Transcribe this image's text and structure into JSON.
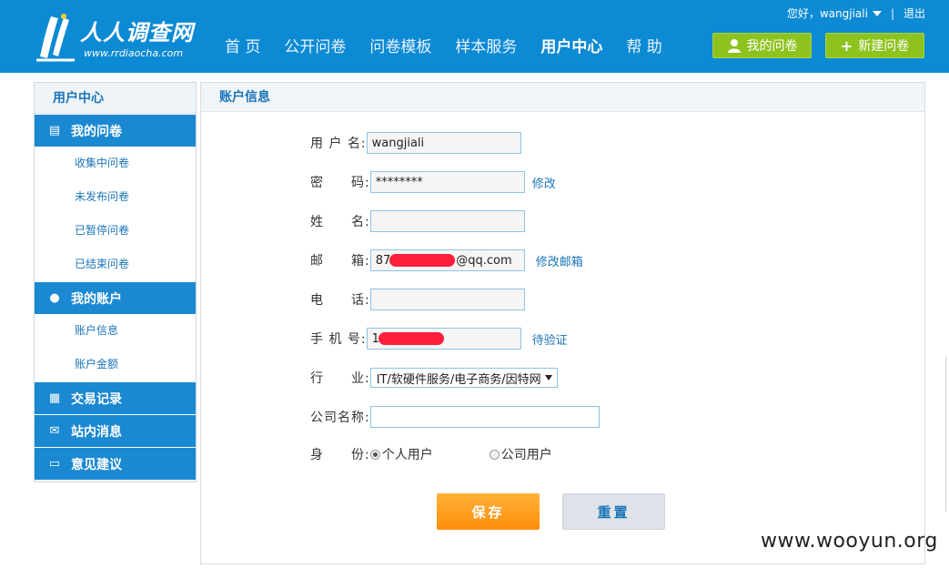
{
  "header": {
    "logo_title": "人人调查网",
    "logo_url": "www.rrdiaocha.com",
    "nav": [
      {
        "label": "首 页",
        "active": false
      },
      {
        "label": "公开问卷",
        "active": false
      },
      {
        "label": "问卷模板",
        "active": false
      },
      {
        "label": "样本服务",
        "active": false
      },
      {
        "label": "用户中心",
        "active": true
      },
      {
        "label": "帮 助",
        "active": false
      }
    ],
    "greeting": "您好，wangjiali",
    "logout": "退出",
    "btn_my_survey": "我的问卷",
    "btn_new_survey": "新建问卷"
  },
  "sidebar": {
    "title": "用户中心",
    "sections": [
      {
        "label": "我的问卷",
        "icon": "clipboard-icon",
        "items": [
          "收集中问卷",
          "未发布问卷",
          "已暂停问卷",
          "已结束问卷"
        ]
      },
      {
        "label": "我的账户",
        "icon": "user-icon",
        "items": [
          "账户信息",
          "账户金额"
        ]
      },
      {
        "label": "交易记录",
        "icon": "ledger-icon",
        "items": []
      },
      {
        "label": "站内消息",
        "icon": "envelope-icon",
        "items": []
      },
      {
        "label": "意见建议",
        "icon": "comment-icon",
        "items": []
      }
    ]
  },
  "main": {
    "title": "账户信息",
    "fields": {
      "username": {
        "label": "用 户 名:",
        "value": "wangjiali"
      },
      "password": {
        "label": "密　　码:",
        "value": "********",
        "action": "修改"
      },
      "realname": {
        "label": "姓　　名:",
        "value": ""
      },
      "email": {
        "label": "邮　　箱:",
        "value_prefix": "87",
        "value_suffix": "@qq.com",
        "action": "修改邮箱"
      },
      "phone": {
        "label": "电　　话:",
        "value": ""
      },
      "mobile": {
        "label": "手 机 号:",
        "value_prefix": "1",
        "action": "待验证"
      },
      "industry": {
        "label": "行　　业:",
        "value": "IT/软硬件服务/电子商务/因特网"
      },
      "company": {
        "label": "公司名称:",
        "value": ""
      },
      "identity": {
        "label": "身　　份:",
        "options": [
          "个人用户",
          "公司用户"
        ],
        "selected": "个人用户"
      }
    },
    "save": "保存",
    "reset": "重置"
  },
  "watermark": "www.wooyun.org",
  "colors": {
    "header_bg": "#0d8ad4",
    "sidebar_section": "#1b88d2",
    "link": "#1a74b8",
    "green_btn": "#8dc21f",
    "orange_btn": "#ff9a1a"
  }
}
